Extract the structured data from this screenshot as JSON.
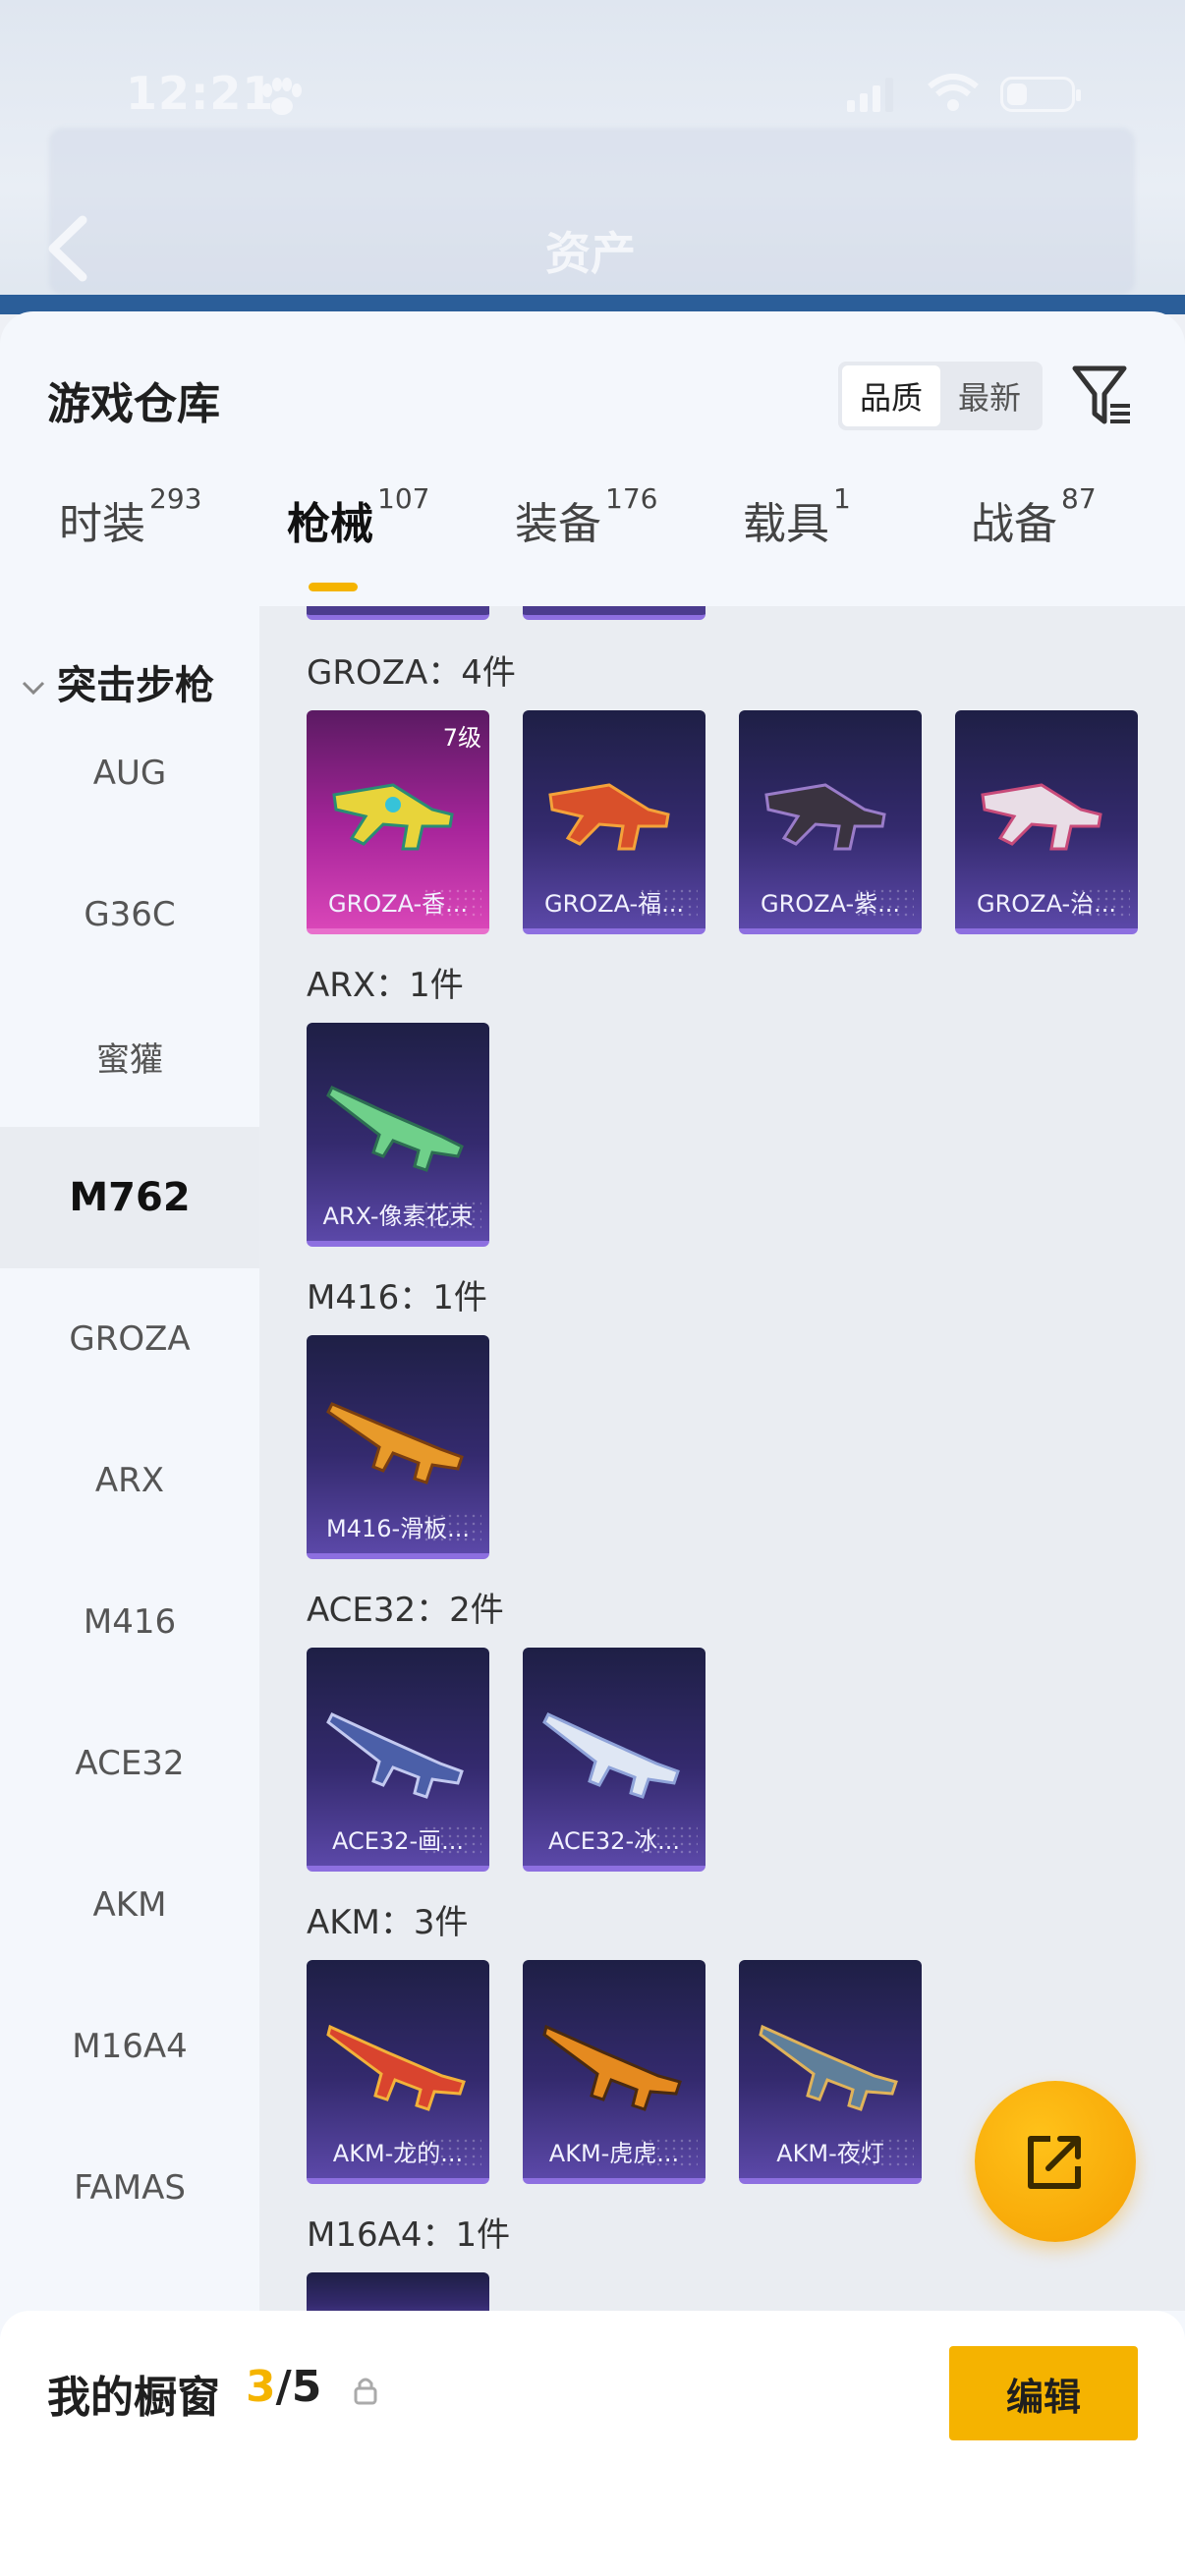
{
  "status_bar": {
    "time": "12:21"
  },
  "header": {
    "title": "资产"
  },
  "sheet": {
    "title": "游戏仓库",
    "sort": {
      "options": [
        "品质",
        "最新"
      ],
      "selected": "品质"
    }
  },
  "tabs": [
    {
      "label": "时装",
      "count": "293"
    },
    {
      "label": "枪械",
      "count": "107",
      "active": true
    },
    {
      "label": "装备",
      "count": "176"
    },
    {
      "label": "载具",
      "count": "1"
    },
    {
      "label": "战备",
      "count": "87"
    }
  ],
  "sidebar": {
    "category": "突击步枪",
    "items": [
      {
        "label": "AUG"
      },
      {
        "label": "G36C"
      },
      {
        "label": "蜜獾"
      },
      {
        "label": "M762",
        "selected": true
      },
      {
        "label": "GROZA"
      },
      {
        "label": "ARX"
      },
      {
        "label": "M416"
      },
      {
        "label": "ACE32"
      },
      {
        "label": "AKM"
      },
      {
        "label": "M16A4"
      },
      {
        "label": "FAMAS"
      }
    ]
  },
  "groups": [
    {
      "title": "GROZA：4件",
      "items": [
        {
          "name": "GROZA-香...",
          "level": "7级",
          "rarity": "pink"
        },
        {
          "name": "GROZA-福...",
          "rarity": "purple"
        },
        {
          "name": "GROZA-紫...",
          "rarity": "purple"
        },
        {
          "name": "GROZA-治...",
          "rarity": "purple"
        }
      ]
    },
    {
      "title": "ARX：1件",
      "items": [
        {
          "name": "ARX-像素花束",
          "rarity": "purple"
        }
      ]
    },
    {
      "title": "M416：1件",
      "items": [
        {
          "name": "M416-滑板...",
          "rarity": "purple"
        }
      ]
    },
    {
      "title": "ACE32：2件",
      "items": [
        {
          "name": "ACE32-画...",
          "rarity": "purple"
        },
        {
          "name": "ACE32-冰...",
          "rarity": "purple"
        }
      ]
    },
    {
      "title": "AKM：3件",
      "items": [
        {
          "name": "AKM-龙的...",
          "rarity": "purple"
        },
        {
          "name": "AKM-虎虎...",
          "rarity": "purple"
        },
        {
          "name": "AKM-夜灯",
          "rarity": "purple"
        }
      ]
    },
    {
      "title": "M16A4：1件",
      "items": []
    }
  ],
  "bottom_bar": {
    "label": "我的橱窗",
    "current": "3",
    "total": "/5",
    "edit_label": "编辑"
  },
  "colors": {
    "accent": "#f5b400",
    "card_purple": "#342a6e",
    "card_pink": "#a8259b"
  }
}
